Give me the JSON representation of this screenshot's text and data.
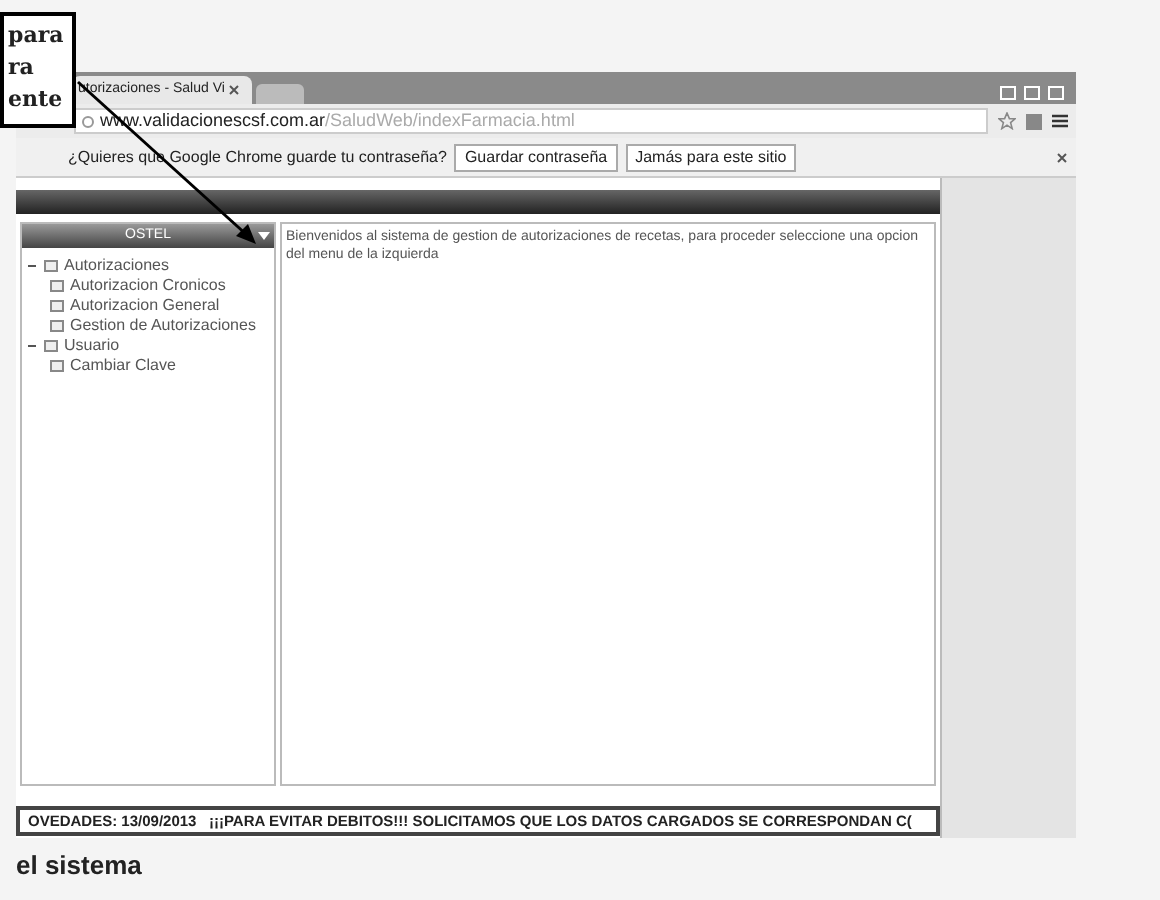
{
  "callout": {
    "lines": [
      "para",
      "ra",
      "ente"
    ]
  },
  "browser": {
    "tab_title": "utorizaciones - Salud Vi",
    "url_host": "www.validacionescsf.com.ar",
    "url_path": "/SaludWeb/indexFarmacia.html",
    "infobar": {
      "message": "¿Quieres que Google Chrome guarde tu contraseña?",
      "buttons": [
        "Guardar contraseña",
        "Jamás para este sitio"
      ]
    }
  },
  "app": {
    "selector": {
      "value": "OSTEL"
    },
    "menu": [
      {
        "label": "Autorizaciones",
        "expanded": true,
        "children": [
          {
            "label": "Autorizacion Cronicos"
          },
          {
            "label": "Autorizacion General"
          },
          {
            "label": "Gestion de Autorizaciones"
          }
        ]
      },
      {
        "label": "Usuario",
        "expanded": true,
        "children": [
          {
            "label": "Cambiar Clave"
          }
        ]
      }
    ],
    "welcome": "Bienvenidos al sistema de gestion de autorizaciones de recetas, para proceder seleccione una opcion del menu de la izquierda",
    "news_ticker": "OVEDADES: 13/09/2013   ¡¡¡PARA EVITAR DEBITOS!!! SOLICITAMOS QUE LOS DATOS CARGADOS SE CORRESPONDAN C("
  },
  "page_caption": "el sistema"
}
